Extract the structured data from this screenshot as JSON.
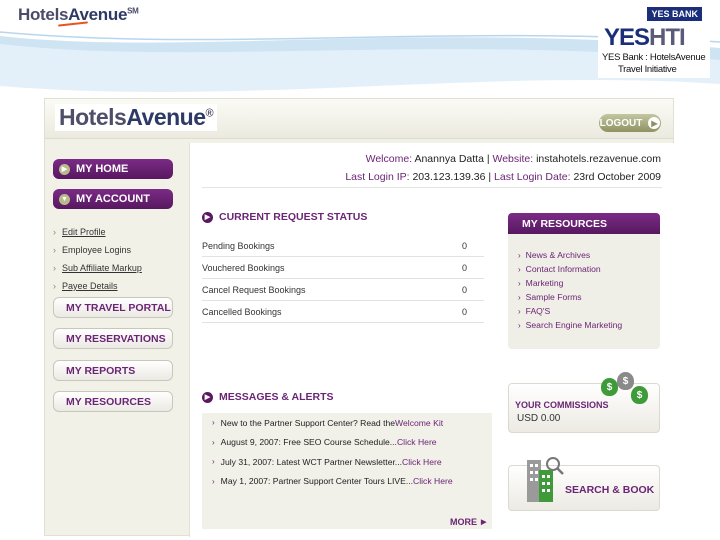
{
  "slide": {
    "logo_text": "Hotels",
    "logo_text2": "Avenue",
    "logo_tm": "SM",
    "bank_badge": "YES BANK",
    "yes": "YES",
    "hti": "HTI",
    "tagline1": "YES Bank : HotelsAvenue",
    "tagline2": "Travel Initiative"
  },
  "header": {
    "logo_text": "Hotels",
    "logo_text2": "Avenue",
    "logo_reg": "®",
    "logout_label": "LOGOUT"
  },
  "nav": {
    "home": "MY HOME",
    "account": "MY ACCOUNT",
    "sub_items": [
      "Edit Profile",
      "Employee Logins",
      "Sub Affiliate Markup",
      "Payee Details"
    ],
    "travel_portal": "MY TRAVEL PORTAL",
    "reservations": "MY RESERVATIONS",
    "reports": "MY REPORTS",
    "resources": "MY RESOURCES"
  },
  "user": {
    "welcome_key": "Welcome:",
    "welcome_name": "Anannya Datta",
    "website_key": "Website:",
    "website_value": "instahotels.rezavenue.com",
    "last_login_ip_key": "Last Login IP:",
    "last_login_ip_value": "203.123.139.36",
    "last_login_date_key": "Last Login Date:",
    "last_login_date_value": "23rd October 2009",
    "separator": "|"
  },
  "request_status": {
    "title": "CURRENT REQUEST STATUS",
    "rows": [
      {
        "label": "Pending Bookings",
        "value": "0"
      },
      {
        "label": "Vouchered Bookings",
        "value": "0"
      },
      {
        "label": "Cancel Request Bookings",
        "value": "0"
      },
      {
        "label": "Cancelled Bookings",
        "value": "0"
      }
    ]
  },
  "messages": {
    "title": "MESSAGES & ALERTS",
    "items": [
      {
        "text": "New to the Partner Support Center? Read the ",
        "link": "Welcome Kit"
      },
      {
        "text": "August 9, 2007: Free SEO Course Schedule... ",
        "link": "Click Here"
      },
      {
        "text": "July 31, 2007: Latest WCT Partner Newsletter... ",
        "link": "Click Here"
      },
      {
        "text": "May 1, 2007: Partner Support Center Tours LIVE... ",
        "link": "Click Here"
      }
    ],
    "more_label": "MORE"
  },
  "resources": {
    "title": "MY RESOURCES",
    "items": [
      "News & Archives",
      "Contact Information",
      "Marketing",
      "Sample Forms",
      "FAQ'S",
      "Search Engine Marketing"
    ]
  },
  "commissions": {
    "title": "YOUR COMMISSIONS",
    "value": "USD 0.00",
    "symbol": "$"
  },
  "search_book": {
    "title": "SEARCH & BOOK"
  },
  "colors": {
    "brand_purple": "#6b2575",
    "olive": "#8e9262",
    "bank_blue": "#1b2e7a"
  }
}
